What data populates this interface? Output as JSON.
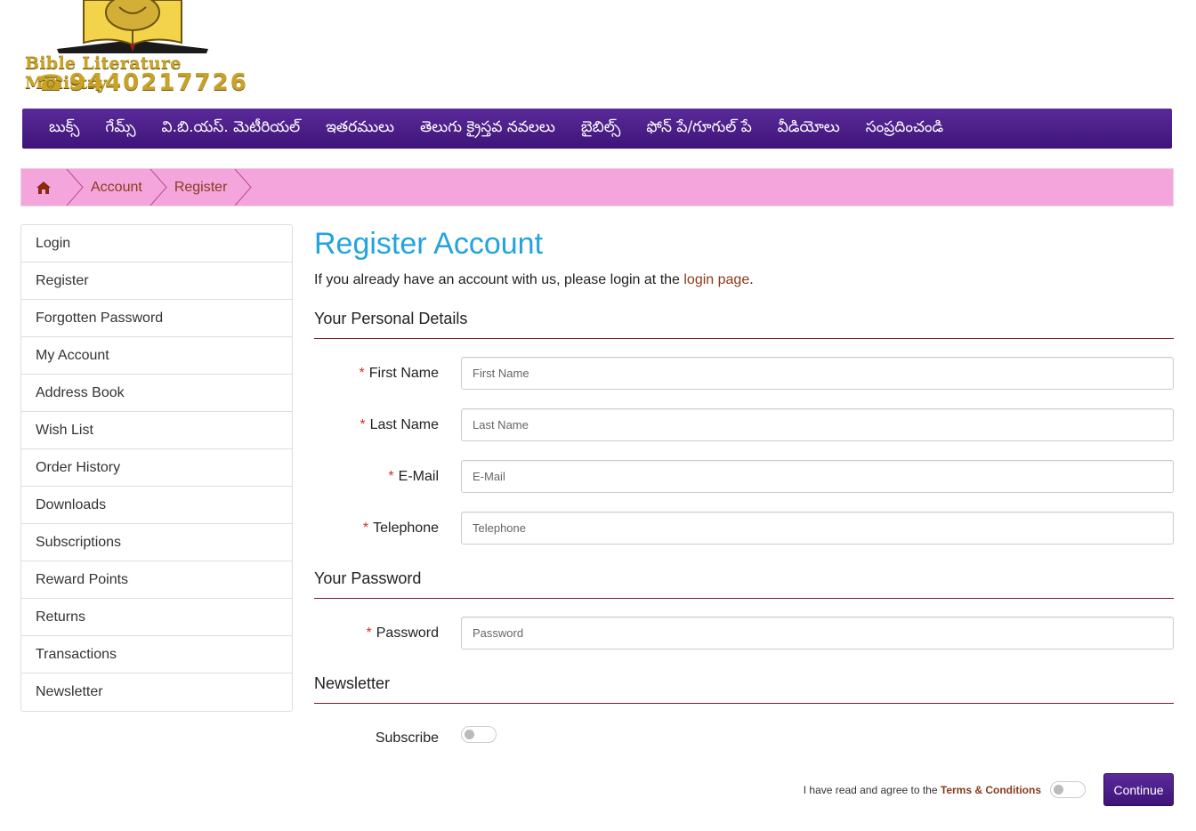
{
  "logo": {
    "title": "Bible Literature Ministry",
    "phone": "9440217726",
    "phone_icon": "☎"
  },
  "nav": {
    "items": [
      "బుక్స్",
      "గేమ్స్",
      "వి.బి.యస్. మెటీరియల్",
      "ఇతరములు",
      "తెలుగు క్రైస్తవ నవలలు",
      "బైబిల్స్",
      "ఫోన్ పే/గూగుల్ పే",
      "వీడియోలు",
      "సంప్రదించండి"
    ]
  },
  "breadcrumb": {
    "items": [
      "Account",
      "Register"
    ]
  },
  "sidebar": {
    "items": [
      {
        "label": "Login"
      },
      {
        "label": "Register"
      },
      {
        "label": "Forgotten Password"
      },
      {
        "label": "My Account"
      },
      {
        "label": "Address Book"
      },
      {
        "label": "Wish List"
      },
      {
        "label": "Order History"
      },
      {
        "label": "Downloads"
      },
      {
        "label": "Subscriptions"
      },
      {
        "label": "Reward Points"
      },
      {
        "label": "Returns"
      },
      {
        "label": "Transactions"
      },
      {
        "label": "Newsletter"
      }
    ]
  },
  "main": {
    "title": "Register Account",
    "intro_text": "If you already have an account with us, please login at the ",
    "intro_link": "login page",
    "intro_end": ".",
    "personal_legend": "Your Personal Details",
    "password_legend": "Your Password",
    "newsletter_legend": "Newsletter",
    "required_mark": "*",
    "fields": {
      "firstname": {
        "label": "First Name",
        "placeholder": "First Name",
        "value": ""
      },
      "lastname": {
        "label": "Last Name",
        "placeholder": "Last Name",
        "value": ""
      },
      "email": {
        "label": "E-Mail",
        "placeholder": "E-Mail",
        "value": ""
      },
      "telephone": {
        "label": "Telephone",
        "placeholder": "Telephone",
        "value": ""
      },
      "password": {
        "label": "Password",
        "placeholder": "Password",
        "value": ""
      }
    },
    "subscribe_label": "Subscribe",
    "agree_text": "I have read and agree to the ",
    "terms_link": "Terms & Conditions",
    "continue_label": "Continue"
  },
  "colors": {
    "nav_bg": "#4b1d8a",
    "breadcrumb_bg": "#f4a6dc",
    "title_color": "#23a3e0",
    "link_color": "#8a3a1a",
    "logo_gold": "#c9a227"
  }
}
